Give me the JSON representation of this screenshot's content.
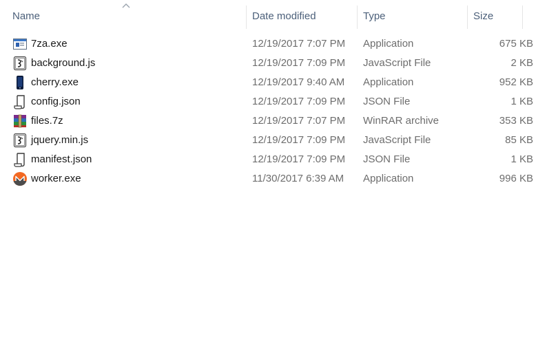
{
  "columns": {
    "name": "Name",
    "date": "Date modified",
    "type": "Type",
    "size": "Size"
  },
  "files": [
    {
      "name": "7za.exe",
      "date": "12/19/2017 7:07 PM",
      "type": "Application",
      "size": "675 KB",
      "icon": "console-app-icon"
    },
    {
      "name": "background.js",
      "date": "12/19/2017 7:09 PM",
      "type": "JavaScript File",
      "size": "2 KB",
      "icon": "javascript-file-icon"
    },
    {
      "name": "cherry.exe",
      "date": "12/19/2017 9:40 AM",
      "type": "Application",
      "size": "952 KB",
      "icon": "cherry-app-icon"
    },
    {
      "name": "config.json",
      "date": "12/19/2017 7:09 PM",
      "type": "JSON File",
      "size": "1 KB",
      "icon": "json-file-icon"
    },
    {
      "name": "files.7z",
      "date": "12/19/2017 7:07 PM",
      "type": "WinRAR archive",
      "size": "353 KB",
      "icon": "winrar-archive-icon"
    },
    {
      "name": "jquery.min.js",
      "date": "12/19/2017 7:09 PM",
      "type": "JavaScript File",
      "size": "85 KB",
      "icon": "javascript-file-icon"
    },
    {
      "name": "manifest.json",
      "date": "12/19/2017 7:09 PM",
      "type": "JSON File",
      "size": "1 KB",
      "icon": "json-file-icon"
    },
    {
      "name": "worker.exe",
      "date": "11/30/2017 6:39 AM",
      "type": "Application",
      "size": "996 KB",
      "icon": "monero-app-icon"
    }
  ],
  "colors": {
    "header_text": "#4c607a",
    "name_text": "#1a1a1a",
    "meta_text": "#6d6d6d",
    "monero_orange": "#f26822"
  }
}
